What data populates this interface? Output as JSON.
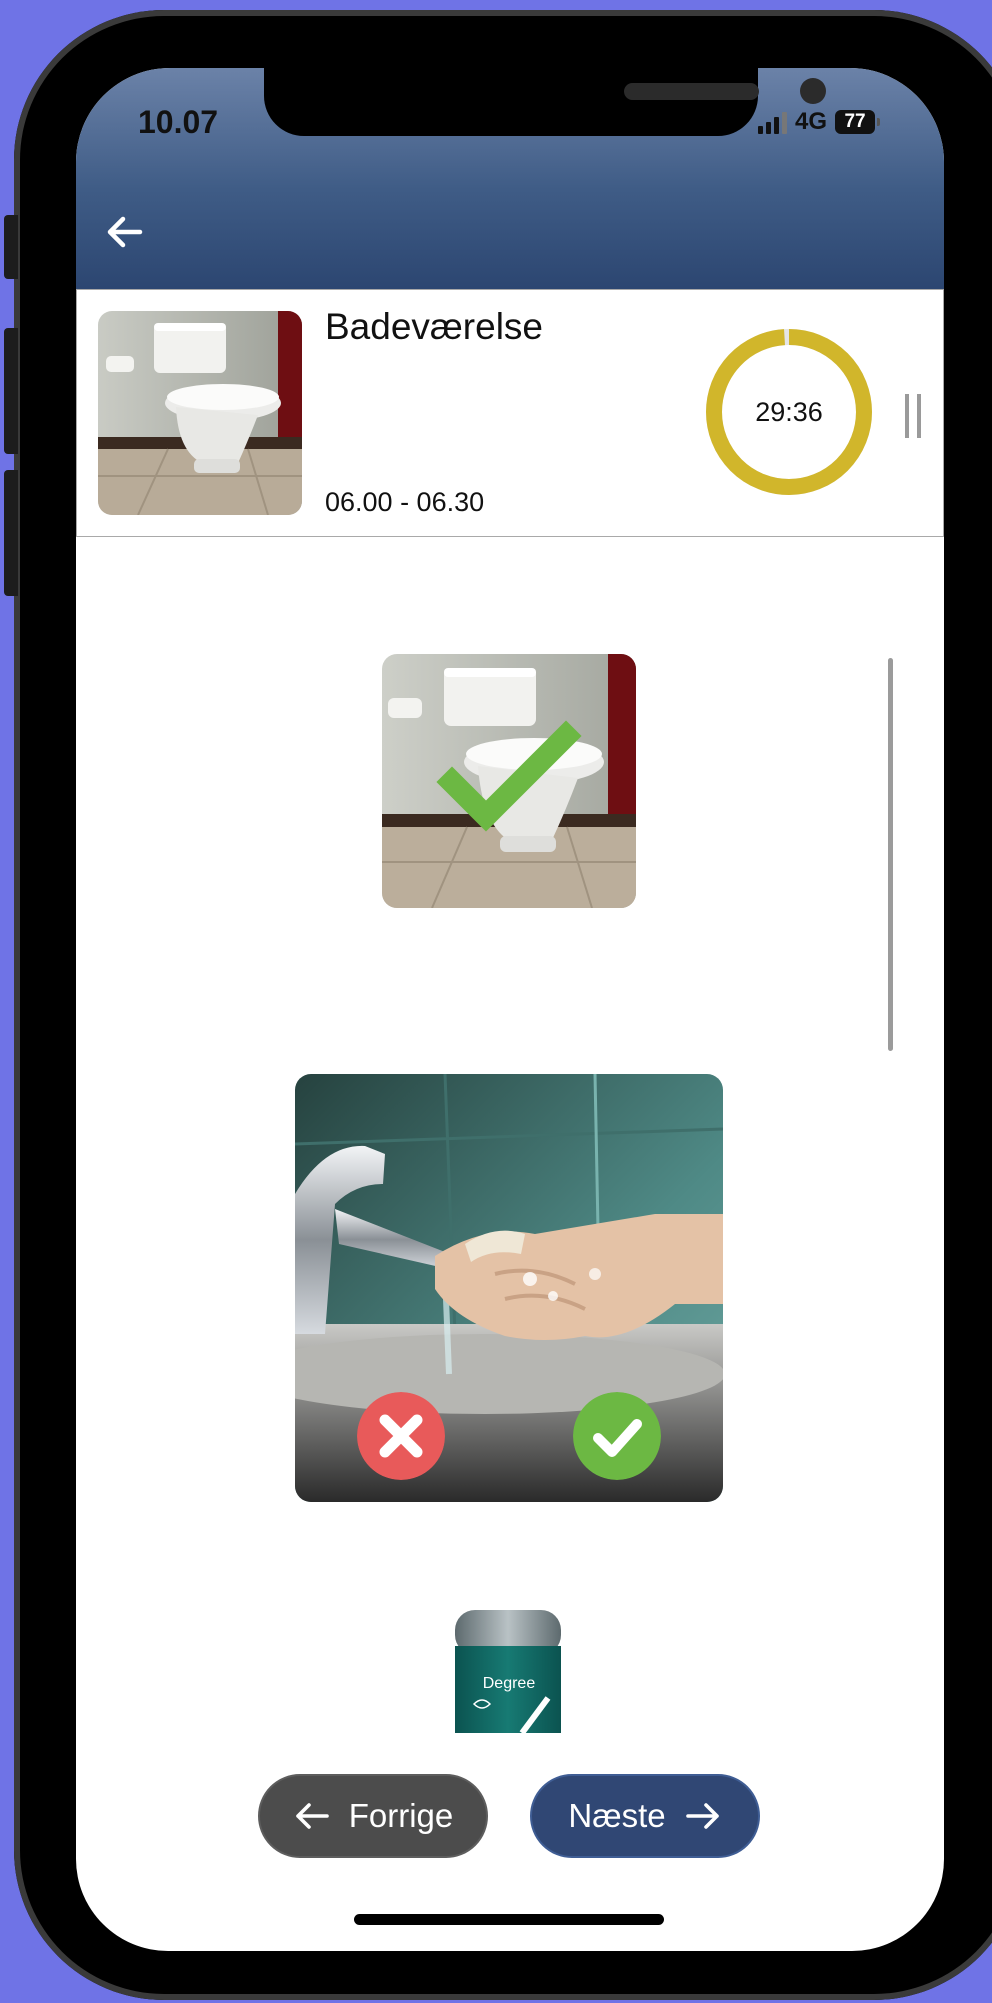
{
  "status_bar": {
    "time": "10.07",
    "network": "4G",
    "battery": "77",
    "signal_icon": "signal-bars-icon"
  },
  "header": {
    "back_icon": "arrow-left-icon"
  },
  "task": {
    "title": "Badeværelse",
    "time_range": "06.00 - 06.30",
    "timer": "29:36",
    "timer_progress": 0.99,
    "timer_color": "#d1b62b",
    "image": "toilet-image"
  },
  "steps": [
    {
      "image": "toilet-image",
      "state": "completed",
      "badge": "checkmark-icon"
    },
    {
      "image": "hand-washing-image",
      "state": "current",
      "actions": [
        "decline-icon",
        "confirm-icon"
      ]
    },
    {
      "image": "deodorant-image",
      "label": "Degree"
    }
  ],
  "navigation": {
    "prev_label": "Forrige",
    "next_label": "Næste",
    "prev_icon": "arrow-left-icon",
    "next_icon": "arrow-right-icon"
  },
  "colors": {
    "header_top": "#6b82a8",
    "header_bottom": "#2c4671",
    "prev_button": "#4c4c4c",
    "next_button": "#304774",
    "confirm": "#6cb843",
    "decline": "#e85a5a"
  }
}
